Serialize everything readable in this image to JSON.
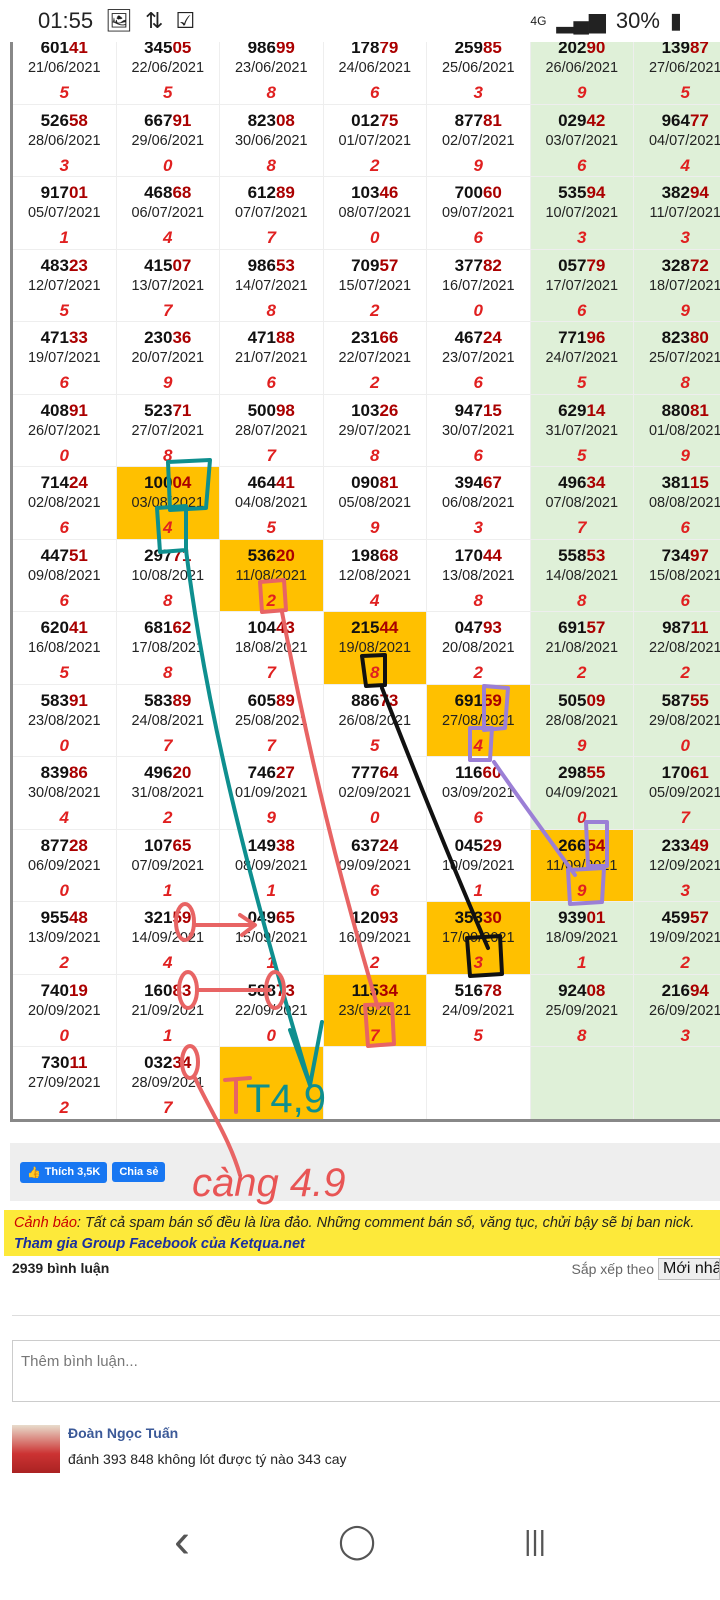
{
  "status_bar": {
    "time": "01:55",
    "battery": "30%",
    "network": "4G"
  },
  "table": {
    "green_columns": [
      5,
      6
    ],
    "highlight_color": "#ffc000",
    "green_color": "#dff0d8",
    "rows": [
      [
        [
          "60141",
          "21/06/2021",
          "5"
        ],
        [
          "34505",
          "22/06/2021",
          "5"
        ],
        [
          "98699",
          "23/06/2021",
          "8"
        ],
        [
          "17879",
          "24/06/2021",
          "6"
        ],
        [
          "25985",
          "25/06/2021",
          "3"
        ],
        [
          "20290",
          "26/06/2021",
          "9"
        ],
        [
          "13987",
          "27/06/2021",
          "5"
        ]
      ],
      [
        [
          "52658",
          "28/06/2021",
          "3"
        ],
        [
          "66791",
          "29/06/2021",
          "0"
        ],
        [
          "82308",
          "30/06/2021",
          "8"
        ],
        [
          "01275",
          "01/07/2021",
          "2"
        ],
        [
          "87781",
          "02/07/2021",
          "9"
        ],
        [
          "02942",
          "03/07/2021",
          "6"
        ],
        [
          "96477",
          "04/07/2021",
          "4"
        ]
      ],
      [
        [
          "91701",
          "05/07/2021",
          "1"
        ],
        [
          "46868",
          "06/07/2021",
          "4"
        ],
        [
          "61289",
          "07/07/2021",
          "7"
        ],
        [
          "10346",
          "08/07/2021",
          "0"
        ],
        [
          "70060",
          "09/07/2021",
          "6"
        ],
        [
          "53594",
          "10/07/2021",
          "3"
        ],
        [
          "38294",
          "11/07/2021",
          "3"
        ]
      ],
      [
        [
          "48323",
          "12/07/2021",
          "5"
        ],
        [
          "41507",
          "13/07/2021",
          "7"
        ],
        [
          "98653",
          "14/07/2021",
          "8"
        ],
        [
          "70957",
          "15/07/2021",
          "2"
        ],
        [
          "37782",
          "16/07/2021",
          "0"
        ],
        [
          "05779",
          "17/07/2021",
          "6"
        ],
        [
          "32872",
          "18/07/2021",
          "9"
        ]
      ],
      [
        [
          "47133",
          "19/07/2021",
          "6"
        ],
        [
          "23036",
          "20/07/2021",
          "9"
        ],
        [
          "47188",
          "21/07/2021",
          "6"
        ],
        [
          "23166",
          "22/07/2021",
          "2"
        ],
        [
          "46724",
          "23/07/2021",
          "6"
        ],
        [
          "77196",
          "24/07/2021",
          "5"
        ],
        [
          "82380",
          "25/07/2021",
          "8"
        ]
      ],
      [
        [
          "40891",
          "26/07/2021",
          "0"
        ],
        [
          "52371",
          "27/07/2021",
          "8"
        ],
        [
          "50098",
          "28/07/2021",
          "7"
        ],
        [
          "10326",
          "29/07/2021",
          "8"
        ],
        [
          "94715",
          "30/07/2021",
          "6"
        ],
        [
          "62914",
          "31/07/2021",
          "5"
        ],
        [
          "88081",
          "01/08/2021",
          "9"
        ]
      ],
      [
        [
          "71424",
          "02/08/2021",
          "6"
        ],
        [
          "10004",
          "03/08/2021",
          "4",
          1
        ],
        [
          "46441",
          "04/08/2021",
          "5"
        ],
        [
          "09081",
          "05/08/2021",
          "9"
        ],
        [
          "39467",
          "06/08/2021",
          "3"
        ],
        [
          "49634",
          "07/08/2021",
          "7"
        ],
        [
          "38115",
          "08/08/2021",
          "6"
        ]
      ],
      [
        [
          "44751",
          "09/08/2021",
          "6"
        ],
        [
          "29771",
          "10/08/2021",
          "8"
        ],
        [
          "53620",
          "11/08/2021",
          "2",
          1
        ],
        [
          "19868",
          "12/08/2021",
          "4"
        ],
        [
          "17044",
          "13/08/2021",
          "8"
        ],
        [
          "55853",
          "14/08/2021",
          "8"
        ],
        [
          "73497",
          "15/08/2021",
          "6"
        ]
      ],
      [
        [
          "62041",
          "16/08/2021",
          "5"
        ],
        [
          "68162",
          "17/08/2021",
          "8"
        ],
        [
          "10443",
          "18/08/2021",
          "7"
        ],
        [
          "21544",
          "19/08/2021",
          "8",
          1
        ],
        [
          "04793",
          "20/08/2021",
          "2"
        ],
        [
          "69157",
          "21/08/2021",
          "2"
        ],
        [
          "98711",
          "22/08/2021",
          "2"
        ]
      ],
      [
        [
          "58391",
          "23/08/2021",
          "0"
        ],
        [
          "58389",
          "24/08/2021",
          "7"
        ],
        [
          "60589",
          "25/08/2021",
          "7"
        ],
        [
          "88673",
          "26/08/2021",
          "5"
        ],
        [
          "69159",
          "27/08/2021",
          "4",
          1
        ],
        [
          "50509",
          "28/08/2021",
          "9"
        ],
        [
          "58755",
          "29/08/2021",
          "0"
        ]
      ],
      [
        [
          "83986",
          "30/08/2021",
          "4"
        ],
        [
          "49620",
          "31/08/2021",
          "2"
        ],
        [
          "74627",
          "01/09/2021",
          "9"
        ],
        [
          "77764",
          "02/09/2021",
          "0"
        ],
        [
          "11660",
          "03/09/2021",
          "6"
        ],
        [
          "29855",
          "04/09/2021",
          "0"
        ],
        [
          "17061",
          "05/09/2021",
          "7"
        ]
      ],
      [
        [
          "87728",
          "06/09/2021",
          "0"
        ],
        [
          "10765",
          "07/09/2021",
          "1"
        ],
        [
          "14938",
          "08/09/2021",
          "1"
        ],
        [
          "63724",
          "09/09/2021",
          "6"
        ],
        [
          "04529",
          "10/09/2021",
          "1"
        ],
        [
          "26654",
          "11/09/2021",
          "9",
          1
        ],
        [
          "23349",
          "12/09/2021",
          "3"
        ]
      ],
      [
        [
          "95548",
          "13/09/2021",
          "2"
        ],
        [
          "32159",
          "14/09/2021",
          "4"
        ],
        [
          "04965",
          "15/09/2021",
          "1"
        ],
        [
          "12093",
          "16/09/2021",
          "2"
        ],
        [
          "35330",
          "17/09/2021",
          "3",
          1
        ],
        [
          "93901",
          "18/09/2021",
          "1"
        ],
        [
          "45957",
          "19/09/2021",
          "2"
        ]
      ],
      [
        [
          "74019",
          "20/09/2021",
          "0"
        ],
        [
          "16083",
          "21/09/2021",
          "1"
        ],
        [
          "58873",
          "22/09/2021",
          "0"
        ],
        [
          "11534",
          "23/09/2021",
          "7",
          1
        ],
        [
          "51678",
          "24/09/2021",
          "5"
        ],
        [
          "92408",
          "25/09/2021",
          "8"
        ],
        [
          "21694",
          "26/09/2021",
          "3"
        ]
      ],
      [
        [
          "73011",
          "27/09/2021",
          "2"
        ],
        [
          "03234",
          "28/09/2021",
          "7"
        ],
        [
          "",
          "",
          "",
          1
        ],
        [
          "",
          "",
          ""
        ],
        [
          "",
          "",
          ""
        ],
        [
          "",
          "",
          ""
        ],
        [
          "",
          "",
          ""
        ]
      ]
    ]
  },
  "annotations": {
    "prediction": "T4,9",
    "note": "càng 4.9"
  },
  "social": {
    "like_label": "Thích 3,5K",
    "share_label": "Chia sẻ"
  },
  "warning": {
    "label": "Cảnh báo",
    "text": ": Tất cả spam bán số đều là lừa đảo. Những comment bán số, văng tục, chửi bậy sẽ bị ban nick.",
    "link": "Tham gia Group Facebook của Ketqua.net"
  },
  "comments": {
    "count": "2939 bình luận",
    "sort_label": "Sắp xếp theo",
    "sort_value": "Mới nhất",
    "placeholder": "Thêm bình luận...",
    "items": [
      {
        "author": "Đoàn Ngọc Tuấn",
        "text": "đánh 393 848 không lót được tý nào 343 cay"
      }
    ]
  },
  "nav": {
    "back": "‹",
    "home": "◯",
    "recents": "|||"
  }
}
